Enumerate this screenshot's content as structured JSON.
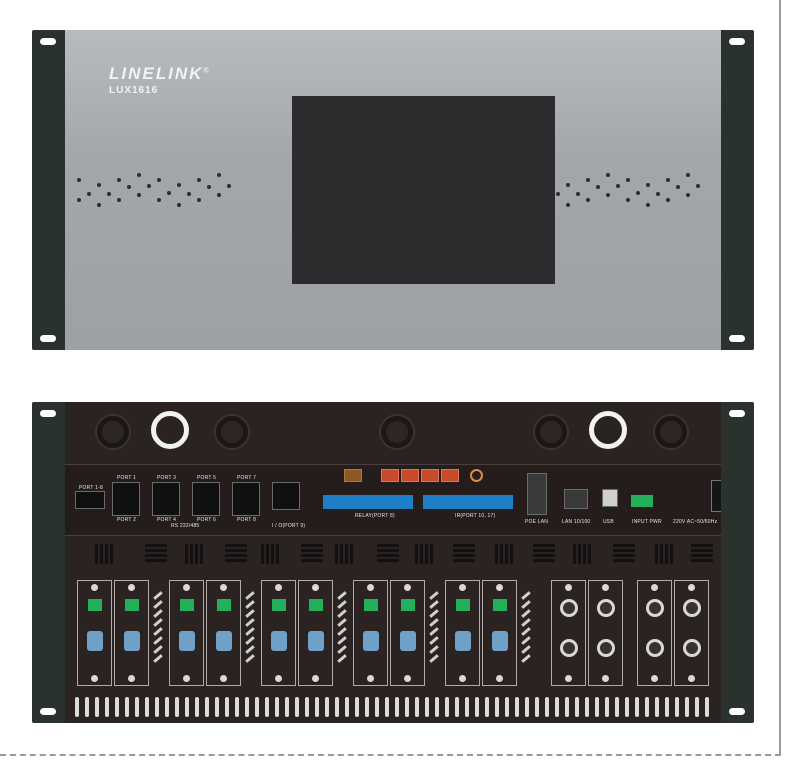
{
  "front": {
    "brand": "LINELINK",
    "brand_mark": "®",
    "model": "LUX1616"
  },
  "rear": {
    "labels": {
      "port_block": "PORT 1-8",
      "port1": "PORT 1",
      "port3": "PORT 3",
      "port5": "PORT 5",
      "port7": "PORT 7",
      "port2": "PORT 2",
      "port4": "PORT 4",
      "port6": "PORT 6",
      "port8": "PORT 8",
      "rs232": "RS 232/485",
      "io_port": "I / O(PORT 9)",
      "relay": "RELAY(PORT 8)",
      "ir": "IR(PORT 10, 17)",
      "poe_lan": "POE LAN",
      "lan": "LAN 10/100",
      "usb": "USB",
      "input_pwr": "INPUT PWR",
      "ac": "220V AC~50/60Hz"
    }
  }
}
